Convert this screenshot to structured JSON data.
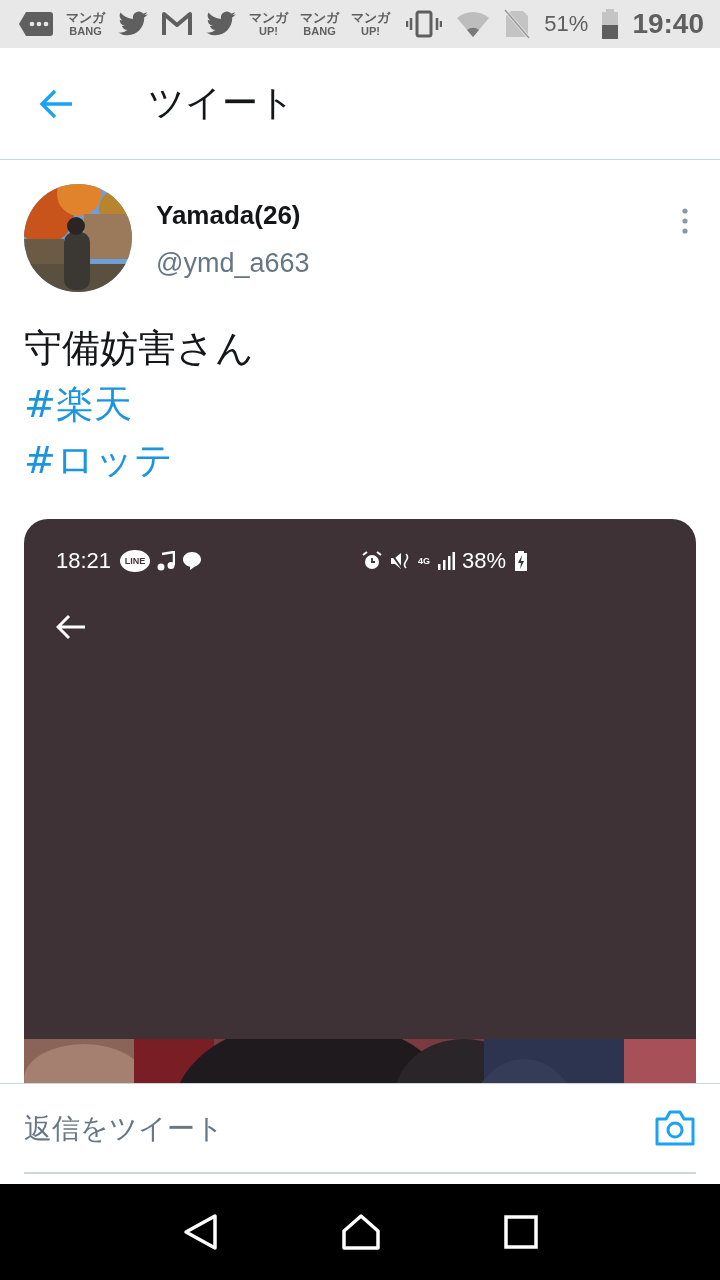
{
  "status_bar": {
    "notifications": [
      {
        "kind": "more"
      },
      {
        "kind": "logo",
        "lines": [
          "マンガ",
          "BANG"
        ]
      },
      {
        "kind": "bird"
      },
      {
        "kind": "mail"
      },
      {
        "kind": "bird"
      },
      {
        "kind": "logo",
        "lines": [
          "マンガ",
          "UP!"
        ]
      },
      {
        "kind": "logo",
        "lines": [
          "マンガ",
          "BANG"
        ]
      },
      {
        "kind": "logo",
        "lines": [
          "マンガ",
          "UP!"
        ]
      }
    ],
    "battery_text": "51%",
    "time": "19:40"
  },
  "header": {
    "title": "ツイート"
  },
  "tweet": {
    "name": "Yamada(26)",
    "handle": "@ymd_a663",
    "lines": [
      {
        "kind": "text",
        "text": "守備妨害さん"
      },
      {
        "kind": "hashtag",
        "text": "#楽天"
      },
      {
        "kind": "hashtag",
        "text": "#ロッテ"
      }
    ],
    "media": {
      "time": "18:21",
      "line_label": "LINE",
      "network": "4G",
      "battery_text": "38%"
    }
  },
  "reply": {
    "placeholder": "返信をツイート"
  }
}
